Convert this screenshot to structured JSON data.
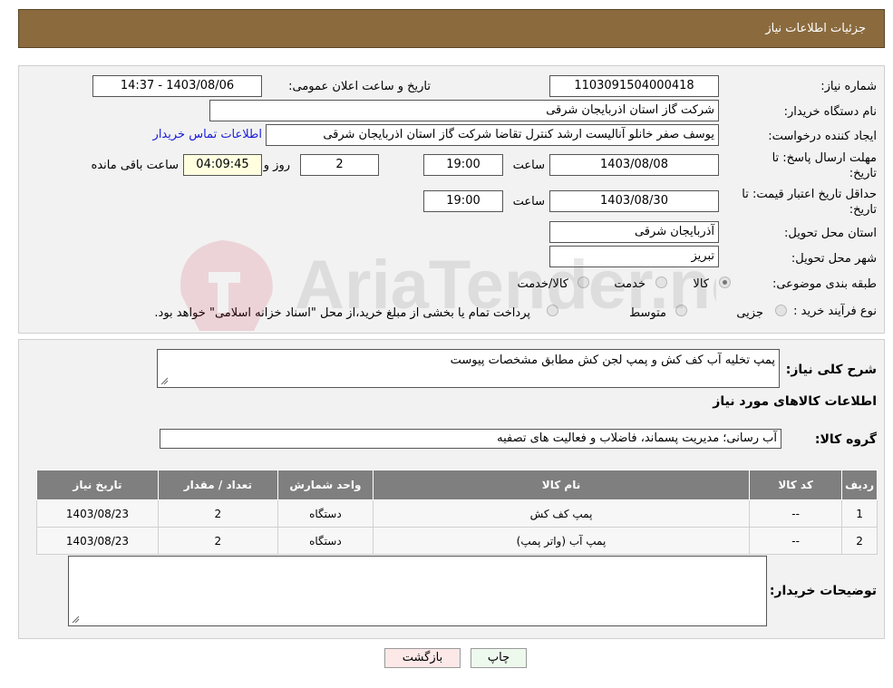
{
  "header": {
    "title": "جزئیات اطلاعات نیاز"
  },
  "form": {
    "need_number_label": "شماره نیاز:",
    "need_number": "1103091504000418",
    "announce_label": "تاریخ و ساعت اعلان عمومی:",
    "announce_value": "1403/08/06 - 14:37",
    "buyer_org_label": "نام دستگاه خریدار:",
    "buyer_org": "شرکت گاز استان اذربایجان شرقی",
    "creator_label": "ایجاد کننده درخواست:",
    "creator": "یوسف صفر خانلو  آنالیست ارشد کنترل تقاضا  شرکت گاز استان اذربایجان شرقی",
    "contact_link": "اطلاعات تماس خریدار",
    "deadline_label_1": "مهلت ارسال پاسخ: تا",
    "deadline_label_2": "تاریخ:",
    "deadline_date": "1403/08/08",
    "time_word": "ساعت",
    "deadline_time": "19:00",
    "days": "2",
    "days_word": "روز و",
    "remaining_time": "04:09:45",
    "remaining_word": "ساعت باقی مانده",
    "validity_label_1": "حداقل تاریخ اعتبار قیمت: تا",
    "validity_label_2": "تاریخ:",
    "validity_date": "1403/08/30",
    "validity_time": "19:00",
    "province_label": "استان محل تحویل:",
    "province": "آذربایجان شرقی",
    "city_label": "شهر محل تحویل:",
    "city": "تبریز",
    "category_label": "طبقه بندی موضوعی:",
    "category_options": [
      "کالا",
      "خدمت",
      "کالا/خدمت"
    ],
    "process_label": "نوع فرآیند خرید :",
    "process_options": [
      "جزیی",
      "متوسط"
    ],
    "process_note": "پرداخت تمام یا بخشی از مبلغ خرید،از محل \"اسناد خزانه اسلامی\" خواهد بود."
  },
  "details": {
    "desc_label": "شرح کلی نیاز:",
    "desc_value": "پمپ تخلیه آب کف کش و پمپ لجن کش مطابق مشخصات پیوست",
    "goods_info_title": "اطلاعات کالاهای مورد نیاز",
    "group_label": "گروه کالا:",
    "group_value": "آب رسانی؛ مدیریت پسماند، فاضلاب و فعالیت های تصفیه",
    "table": {
      "headers": [
        "ردیف",
        "کد کالا",
        "نام کالا",
        "واحد شمارش",
        "تعداد / مقدار",
        "تاریخ نیاز"
      ],
      "rows": [
        [
          "1",
          "--",
          "پمپ کف کش",
          "دستگاه",
          "2",
          "1403/08/23"
        ],
        [
          "2",
          "--",
          "پمپ آب (واتر پمپ)",
          "دستگاه",
          "2",
          "1403/08/23"
        ]
      ]
    },
    "buyer_notes_label": "توضیحات خریدار:"
  },
  "buttons": {
    "print": "چاپ",
    "back": "بازگشت"
  },
  "watermark_text": "AriaTender.neT",
  "colors": {
    "header": "#8B6B3E",
    "print_bg": "#eef9ee",
    "back_bg": "#fde8e8"
  }
}
